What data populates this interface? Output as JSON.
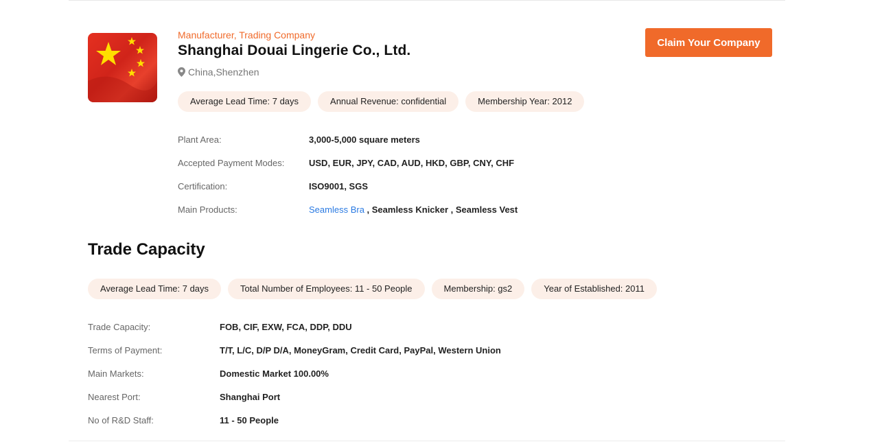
{
  "company": {
    "type": "Manufacturer, Trading Company",
    "name": "Shanghai Douai Lingerie Co., Ltd.",
    "location": "China,Shenzhen",
    "logo_icon": "china-flag-icon",
    "claim_label": "Claim Your Company",
    "accent_color": "#f06a2a",
    "pills": [
      "Average Lead Time: 7 days",
      "Annual Revenue: confidential",
      "Membership Year: 2012"
    ],
    "details": [
      {
        "label": "Plant Area:",
        "value": "3,000-5,000 square meters"
      },
      {
        "label": "Accepted Payment Modes:",
        "value": "USD, EUR, JPY, CAD, AUD, HKD, GBP, CNY, CHF"
      },
      {
        "label": "Certification:",
        "value": "ISO9001, SGS"
      },
      {
        "label": "Main Products:",
        "link": "Seamless Bra",
        "value": " , Seamless Knicker , Seamless Vest"
      }
    ]
  },
  "trade": {
    "title": "Trade Capacity",
    "pills": [
      "Average Lead Time: 7 days",
      "Total Number of Employees: 11 - 50 People",
      "Membership: gs2",
      "Year of Established: 2011"
    ],
    "details": [
      {
        "label": "Trade Capacity:",
        "value": "FOB, CIF, EXW, FCA, DDP, DDU"
      },
      {
        "label": "Terms of Payment:",
        "value": "T/T, L/C, D/P D/A, MoneyGram, Credit Card, PayPal, Western Union"
      },
      {
        "label": "Main Markets:",
        "value": "Domestic Market 100.00%"
      },
      {
        "label": "Nearest Port:",
        "value": "Shanghai Port"
      },
      {
        "label": "No of R&D Staff:",
        "value": "11 - 50 People"
      }
    ]
  }
}
